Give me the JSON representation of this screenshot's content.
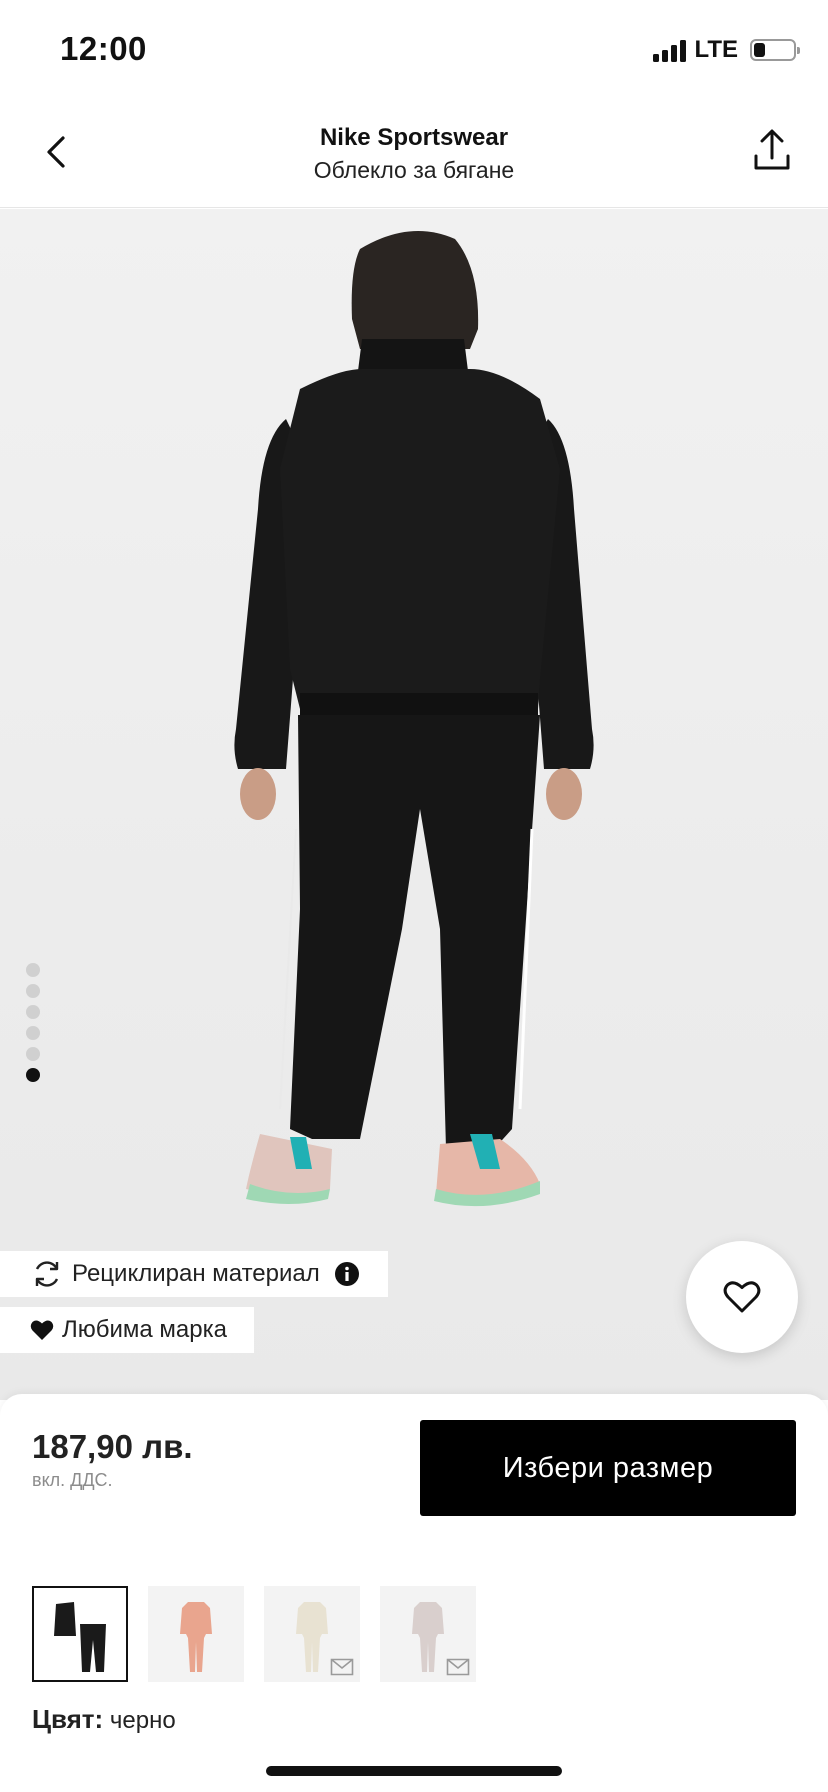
{
  "status_bar": {
    "time": "12:00",
    "network": "LTE",
    "battery_level": 0.3
  },
  "header": {
    "brand": "Nike Sportswear",
    "subtitle": "Облекло за бягане",
    "back_icon": "chevron-left-icon",
    "share_icon": "share-icon"
  },
  "gallery": {
    "image_count": 6,
    "active_index": 5
  },
  "badges": {
    "recycled": "Рециклиран материал",
    "favorite_brand": "Любима марка"
  },
  "product": {
    "price": "187,90 лв.",
    "vat_note": "вкл. ДДС.",
    "select_size_label": "Избери размер"
  },
  "color_variants": [
    {
      "name": "black",
      "tone": "#1a1a1a",
      "selected": true,
      "notify": false
    },
    {
      "name": "peach",
      "tone": "#e9a58e",
      "selected": false,
      "notify": false
    },
    {
      "name": "cream",
      "tone": "#e8e2d2",
      "selected": false,
      "notify": true
    },
    {
      "name": "grey-pink",
      "tone": "#d9cfcd",
      "selected": false,
      "notify": true
    }
  ],
  "color": {
    "label": "Цвят:",
    "value": "черно"
  },
  "colors": {
    "accent": "#000000",
    "background": "#ffffff",
    "muted": "#8c8c8c"
  }
}
